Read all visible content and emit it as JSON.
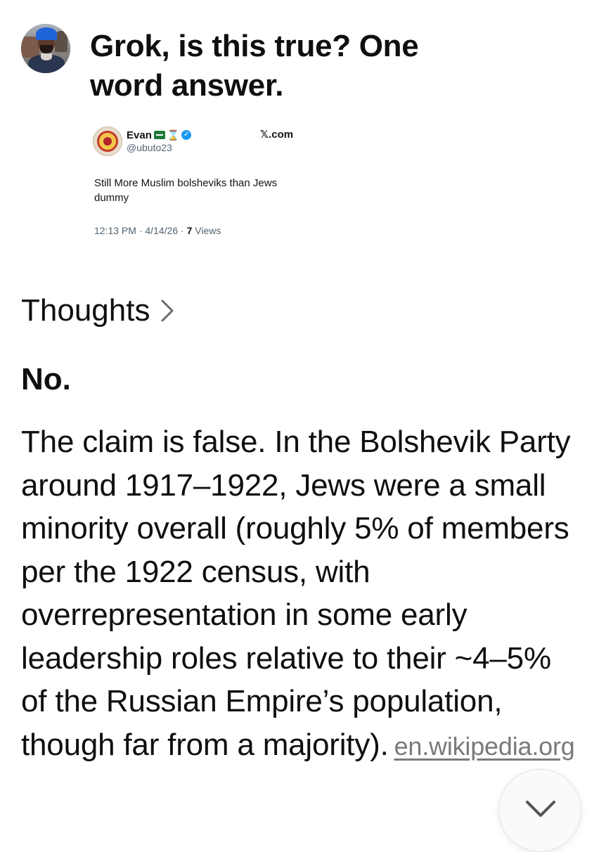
{
  "user_message": {
    "text": "Grok, is this true? One word answer."
  },
  "quoted_post": {
    "author_name": "Evan",
    "author_handle": "@ubuto23",
    "source": "𝕏.com",
    "text": "Still More Muslim bolsheviks than Jews dummy",
    "time": "12:13 PM",
    "date": "4/14/26",
    "views_count": "7",
    "views_label": "Views"
  },
  "response": {
    "thoughts_label": "Thoughts",
    "short_answer": "No.",
    "body": "The claim is false. In the Bolshevik Party around 1917–1922, Jews were a small minority overall (roughly 5% of members per the 1922 census, with overrepresentation in some early leadership roles relative to their ~4–5% of the Russian Empire’s population, though far from a majority).",
    "source_link": "en.wikipedia.org"
  },
  "icons": {
    "thoughts_chevron": "chevron-right-icon",
    "scroll_button": "chevron-down-icon",
    "verified": "verified-badge-icon"
  },
  "colors": {
    "text": "#0f0f0f",
    "link": "#7a7a7a",
    "verified": "#1d9bf0",
    "secondary": "#536471"
  }
}
